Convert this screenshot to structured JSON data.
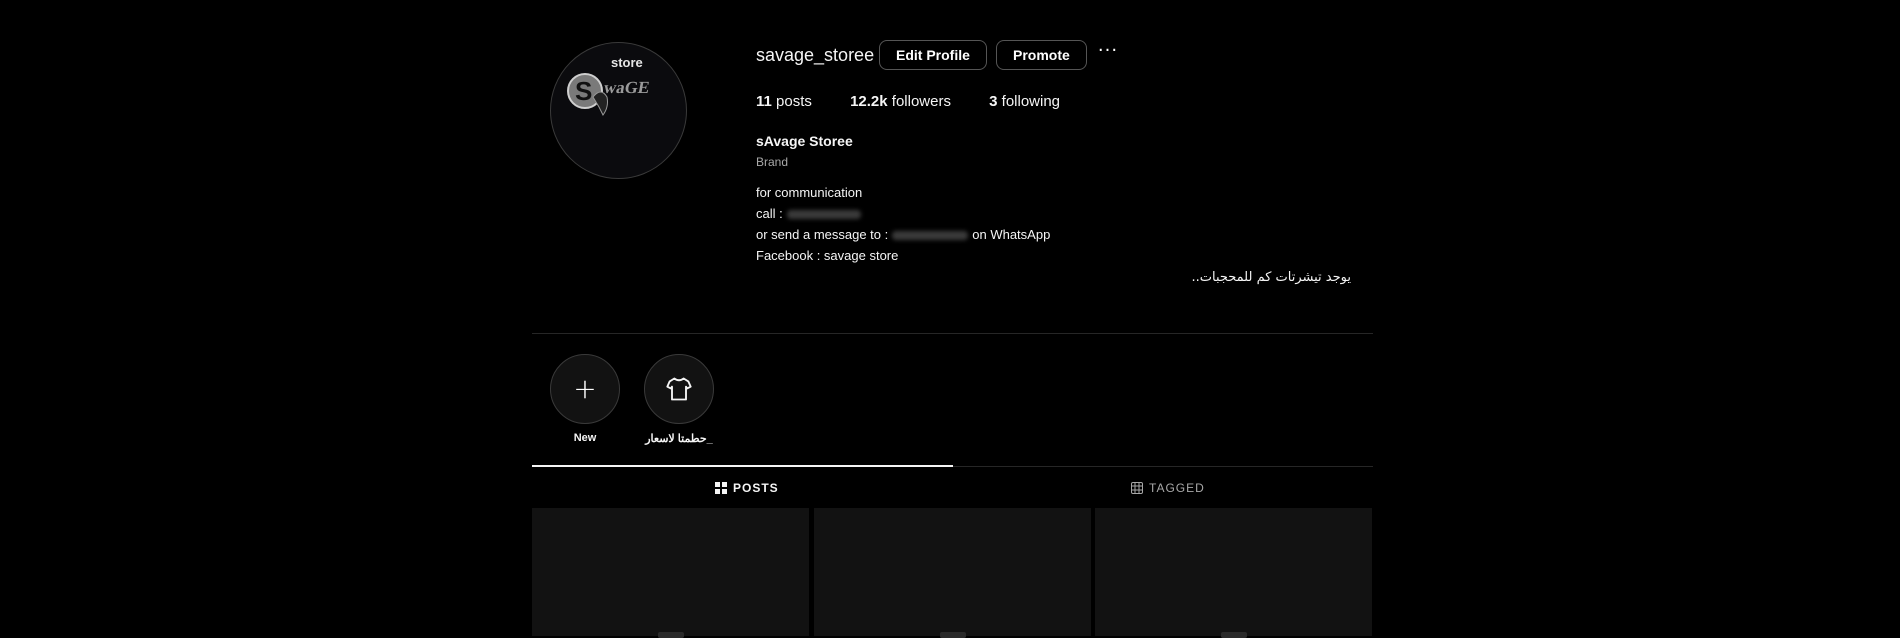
{
  "profile": {
    "username": "savage_storee",
    "logo_top": "store",
    "logo_bottom": "waGE",
    "edit_label": "Edit Profile",
    "promote_label": "Promote",
    "more_label": "···",
    "stats": {
      "posts_count": "11",
      "posts_label": "posts",
      "followers_count": "12.2k",
      "followers_label": "followers",
      "following_count": "3",
      "following_label": "following"
    },
    "display_name": "sAvage Storee",
    "category": "Brand",
    "bio": {
      "line1": "for communication",
      "line2_prefix": "call :",
      "line3_prefix": "or send a message to :",
      "line3_suffix": "on WhatsApp",
      "line4": "Facebook : savage store",
      "arabic": "يوجد تيشرتات كم للمحجبات.."
    }
  },
  "highlights": [
    {
      "label": "New",
      "icon": "plus-icon"
    },
    {
      "label": "حطمتا لاسعار_",
      "icon": "tshirt-icon"
    }
  ],
  "tabs": {
    "posts": "POSTS",
    "tagged": "TAGGED"
  },
  "colors": {
    "background": "#000000",
    "text": "#f5f5f5",
    "muted": "#a8a8a8",
    "border": "#262626"
  }
}
